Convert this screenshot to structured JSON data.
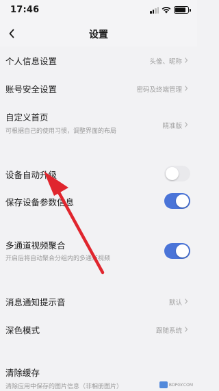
{
  "status_bar": {
    "time": "17:46",
    "battery_level": 0.85
  },
  "header": {
    "title": "设置"
  },
  "settings": {
    "personal_info": {
      "label": "个人信息设置",
      "value": "头像、昵称"
    },
    "account_security": {
      "label": "账号安全设置",
      "value": "密码及终端管理"
    },
    "custom_home": {
      "label": "自定义首页",
      "sub": "可根据自己的使用习惯，调整界面的布局",
      "value": "精准版"
    },
    "auto_upgrade": {
      "label": "设备自动升级",
      "enabled": false
    },
    "save_device_info": {
      "label": "保存设备参数信息",
      "enabled": true
    },
    "multi_channel": {
      "label": "多通道视频聚合",
      "sub": "开启后将自动聚合分组内的多通道视频",
      "enabled": true
    },
    "notification_sound": {
      "label": "消息通知提示音",
      "value": "默认"
    },
    "dark_mode": {
      "label": "深色模式",
      "value": "跟随系统"
    },
    "clear_cache": {
      "label": "清除缓存",
      "sub": "清除应用中保存的图片信息（非相册图片）"
    }
  },
  "watermark": {
    "text": "BDPGY.COM"
  },
  "icons": {
    "back": "chevron-left-icon",
    "chevron": "chevron-right-icon",
    "arrow": "red-annotation-arrow",
    "watermark": "watermark-logo"
  },
  "colors": {
    "toggle_on": "#4a74d8",
    "toggle_off": "#e9e9ec",
    "annotation_arrow": "#e0262e",
    "background": "#f2f2f4"
  }
}
